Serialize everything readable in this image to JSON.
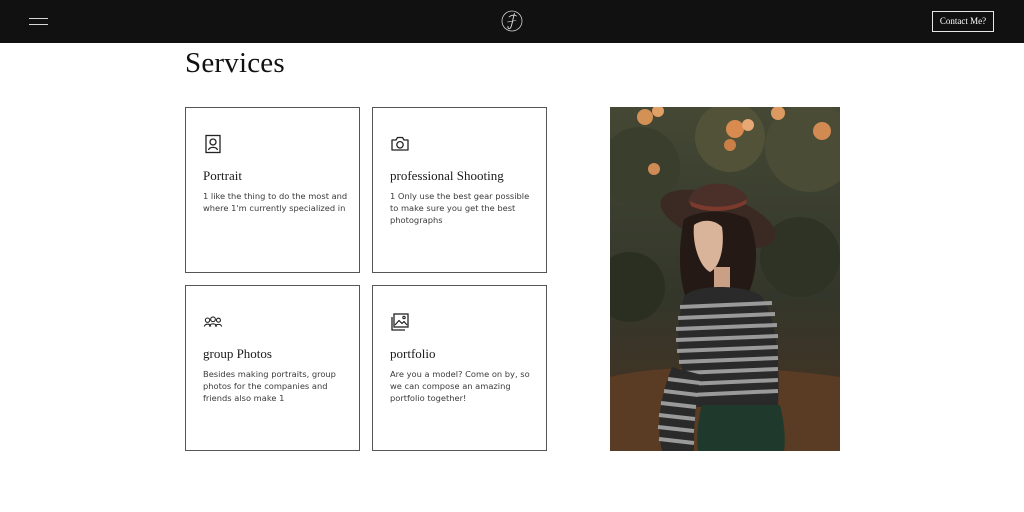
{
  "header": {
    "menu_icon": "hamburger-icon",
    "logo_icon": "signature-monogram-icon",
    "contact_label": "Contact Me?"
  },
  "services": {
    "title": "Services",
    "cards": [
      {
        "icon": "portrait-frame-icon",
        "title": "Portrait",
        "text": "1 like the thing to do the most and where 1'm currently specialized in"
      },
      {
        "icon": "camera-icon",
        "title": "professional Shooting",
        "text": "1 Only use the best gear possible to make sure you get the best photographs"
      },
      {
        "icon": "group-people-icon",
        "title": "group Photos",
        "text": "Besides making portraits, group photos for the companies and friends also make 1"
      },
      {
        "icon": "image-gallery-icon",
        "title": "portfolio",
        "text": "Are you a model? Come on by, so we can compose an amazing portfolio together!"
      }
    ]
  },
  "photo": {
    "subject": "woman-in-hat-photo",
    "colors": {
      "foliage": "#3e4230",
      "flowers": "#d9915a",
      "ground": "#5a3b24"
    }
  }
}
